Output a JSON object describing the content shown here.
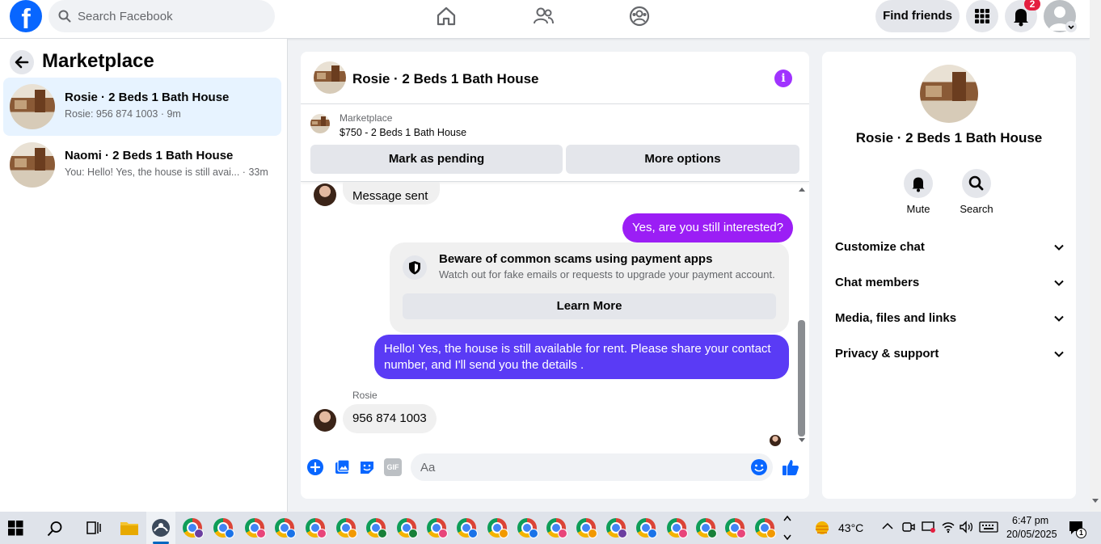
{
  "topbar": {
    "logo": "f",
    "search_placeholder": "Search Facebook",
    "find_friends_label": "Find friends",
    "notification_count": "2",
    "nav_icons": [
      "home-icon",
      "friends-icon",
      "groups-icon"
    ]
  },
  "left": {
    "title": "Marketplace",
    "conversations": [
      {
        "name": "Rosie · 2 Beds 1 Bath House",
        "preview": "Rosie: 956 874 1003 · 9m",
        "active": true
      },
      {
        "name": "Naomi · 2 Beds 1 Bath House",
        "preview": "You: Hello! Yes, the house is still avai... · 33m",
        "active": false
      }
    ]
  },
  "chat": {
    "title": "Rosie · 2 Beds 1 Bath House",
    "marketplace_label": "Marketplace",
    "listing": "$750 - 2 Beds 1 Bath House",
    "mark_pending": "Mark as pending",
    "more_options": "More options",
    "messages": {
      "msg_sent": "Message sent",
      "out_1": "Yes, are you still interested?",
      "scam_title": "Beware of common scams using payment apps",
      "scam_body": "Watch out for fake emails or requests to upgrade your payment account.",
      "learn_more": "Learn More",
      "out_2": "Hello! Yes, the house is still available for rent. Please share your contact number, and I'll send you the details .",
      "sender_name": "Rosie",
      "in_1": "956 874 1003"
    },
    "composer_placeholder": "Aa",
    "composer_icons": [
      "plus-icon",
      "photo-icon",
      "sticker-icon",
      "gif-icon",
      "emoji-icon",
      "like-icon"
    ],
    "gif_label": "GIF"
  },
  "right": {
    "name": "Rosie · 2 Beds 1 Bath House",
    "mute_label": "Mute",
    "search_label": "Search",
    "sections": [
      "Customize chat",
      "Chat members",
      "Media, files and links",
      "Privacy & support"
    ]
  },
  "taskbar": {
    "temperature": "43°C",
    "time": "6:47 pm",
    "date": "20/05/2025",
    "notification_count": "1"
  },
  "colors": {
    "accent": "#0866ff",
    "outgoing_1": "#9b1ef5",
    "outgoing_2": "#5a3bf5",
    "info": "#a033ff",
    "active_conv": "#e7f3ff"
  }
}
